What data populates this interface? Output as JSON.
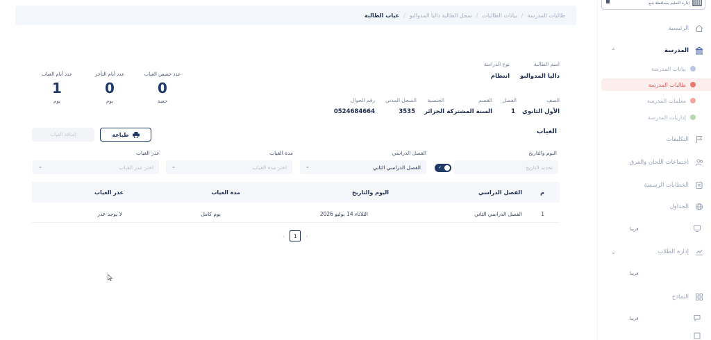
{
  "sidebar": {
    "top_label": "إدارة التعليم بمحافظة ينبع",
    "items": [
      {
        "label": "الرئيسية"
      },
      {
        "label": "المدرسة"
      },
      {
        "label": "التكليفات"
      },
      {
        "label": "اجتماعات اللجان والفرق"
      },
      {
        "label": "الخطابات الرسمية"
      },
      {
        "label": "الجداول"
      },
      {
        "label": "إدارة الطلاب"
      },
      {
        "label": "النماذج"
      }
    ],
    "sub_items": [
      {
        "label": "بيانات المدرسة",
        "dot_color": "#b9c7e6"
      },
      {
        "label": "طالبات المدرسة",
        "dot_color": "#e87b70"
      },
      {
        "label": "معلمات المدرسة",
        "dot_color": "#f2a6a0"
      },
      {
        "label": "إداريات المدرسة",
        "dot_color": "#b7d9b0"
      }
    ],
    "soon_label": "قريبا"
  },
  "breadcrumb": {
    "items": [
      "طالبات المدرسة",
      "بيانات الطالبات",
      "سجل الطالبة داليا المدوالبو",
      "غياب الطالبة"
    ],
    "separator": "/"
  },
  "student": {
    "name_label": "اسم الطالبة",
    "name": "داليا المدوالبو",
    "study_type_label": "نوع الدراسة",
    "study_type": "انتظام",
    "grade_label": "الصف",
    "grade": "الأول الثانوي",
    "class_label": "الفصل",
    "class": "1",
    "section_label": "القسم",
    "section": "السنة المشتركة",
    "nationality_label": "الجنسية",
    "nationality": "الجزائر",
    "civil_label": "السجل المدني",
    "civil": "3535",
    "mobile_label": "رقم الجوال",
    "mobile": "0524684664"
  },
  "stats": [
    {
      "label": "عدد حصص الغياب",
      "value": "0",
      "unit": "حصة"
    },
    {
      "label": "عدد أيام التأخر",
      "value": "0",
      "unit": "يوم"
    },
    {
      "label": "عدد أيام الغياب",
      "value": "1",
      "unit": "يوم"
    }
  ],
  "absence": {
    "title": "الغياب",
    "print_label": "طباعة",
    "add_label": "إضافة الغياب"
  },
  "filters": {
    "date_label": "اليوم والتاريخ",
    "date_placeholder": "تحديد التاريخ",
    "semester_label": "الفصل الدراسي",
    "semester_value": "الفصل الدراسي الثاني",
    "duration_label": "مدة الغياب",
    "duration_placeholder": "اختر مدة الغياب",
    "excuse_label": "عذر الغياب",
    "excuse_placeholder": "اختر عذر الغياب"
  },
  "table": {
    "headers": [
      "م",
      "الفصل الدراسي",
      "اليوم والتاريخ",
      "مدة الغياب",
      "عذر الغياب"
    ],
    "rows": [
      [
        "1",
        "الفصل الدراسي الثاني",
        "الثلاثاء 14 يوليو 2026",
        "يوم كامل",
        "لا يوجد عذر"
      ]
    ]
  },
  "pagination": {
    "current": "1",
    "prev": "‹",
    "next": "›"
  },
  "colors": {
    "primary": "#1f3a66",
    "accent_red": "#e0625b",
    "muted": "#9aa5b9"
  }
}
